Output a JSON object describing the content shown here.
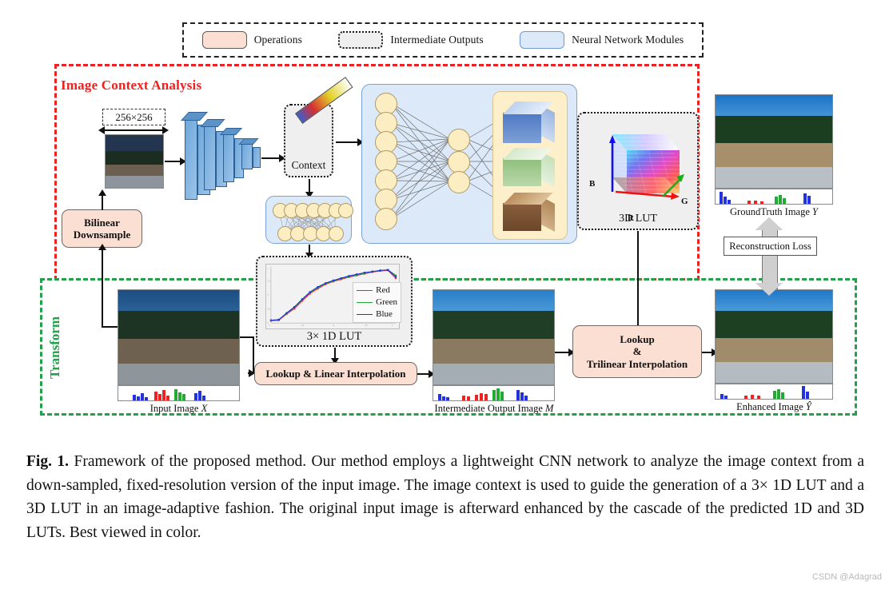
{
  "legend": {
    "items": [
      {
        "label": "Operations",
        "swatch": "op",
        "color": "#fbdfd3"
      },
      {
        "label": "Intermediate Outputs",
        "swatch": "im",
        "color": "#efefef"
      },
      {
        "label": "Neural Network Modules",
        "swatch": "nn",
        "color": "#dce9f8"
      }
    ]
  },
  "regions": {
    "image_context_analysis": {
      "title": "Image Context Analysis",
      "color": "#ef2020"
    },
    "transform": {
      "title": "Transform",
      "color": "#22a14a"
    }
  },
  "nodes": {
    "resolution_tag": "256×256",
    "bilinear_downsample": "Bilinear\nDownsample",
    "bilinear_line1": "Bilinear",
    "bilinear_line2": "Downsample",
    "context_label": "Context",
    "lut3d_label": "3D LUT",
    "lut3d_axis_r": "R",
    "lut3d_axis_g": "G",
    "lut3d_axis_b": "B",
    "lut1d_label": "3× 1D LUT",
    "lookup_linear": "Lookup & Linear Interpolation",
    "lookup_trilinear_line1": "Lookup",
    "lookup_trilinear_line2": "&",
    "lookup_trilinear_line3": "Trilinear Interpolation",
    "reconstruction_loss": "Reconstruction Loss"
  },
  "images": {
    "downsampled": {
      "caption": ""
    },
    "input": {
      "caption": "Input Image X",
      "caption_plain": "Input Image",
      "caption_italic": "X"
    },
    "intermediate": {
      "caption": "Intermediate Output Image M",
      "caption_plain": "Intermediate Output Image",
      "caption_italic": "M"
    },
    "enhanced": {
      "caption": "Enhanced Image Ŷ",
      "caption_plain": "Enhanced Image",
      "caption_italic": "Ŷ"
    },
    "groundtruth": {
      "caption": "GroundTruth Image Y",
      "caption_plain": "GroundTruth Image",
      "caption_italic": "Y"
    }
  },
  "chart_data": {
    "type": "line",
    "title": "3× 1D LUT",
    "xlabel": "",
    "ylabel": "",
    "xlim": [
      0,
      1
    ],
    "ylim": [
      0,
      1
    ],
    "grid": false,
    "legend_position": "lower right",
    "x": [
      0.0,
      0.0625,
      0.125,
      0.1875,
      0.25,
      0.3125,
      0.375,
      0.4375,
      0.5,
      0.5625,
      0.625,
      0.6875,
      0.75,
      0.8125,
      0.875,
      0.9375,
      1.0
    ],
    "series": [
      {
        "name": "Red",
        "color": "#ee2222",
        "values": [
          0.04,
          0.05,
          0.16,
          0.26,
          0.4,
          0.53,
          0.62,
          0.7,
          0.75,
          0.79,
          0.83,
          0.86,
          0.89,
          0.92,
          0.94,
          0.95,
          0.81
        ]
      },
      {
        "name": "Green",
        "color": "#22aa33",
        "values": [
          0.05,
          0.06,
          0.17,
          0.28,
          0.42,
          0.55,
          0.64,
          0.71,
          0.76,
          0.8,
          0.84,
          0.87,
          0.9,
          0.93,
          0.95,
          0.96,
          0.86
        ]
      },
      {
        "name": "Blue",
        "color": "#2233dd",
        "values": [
          0.05,
          0.06,
          0.18,
          0.29,
          0.43,
          0.56,
          0.65,
          0.72,
          0.77,
          0.81,
          0.85,
          0.88,
          0.91,
          0.93,
          0.95,
          0.96,
          0.84
        ]
      }
    ]
  },
  "caption": {
    "label": "Fig. 1.",
    "text": " Framework of the proposed method. Our method employs a lightweight CNN network to analyze the image context from a down-sampled, fixed-resolution version of the input image. The image context is used to guide the generation of a 3× 1D LUT and a 3D LUT in an image-adaptive fashion. The original input image is afterward enhanced by the cascade of the predicted 1D and 3D LUTs. Best viewed in color."
  },
  "watermark": "CSDN @Adagrad"
}
